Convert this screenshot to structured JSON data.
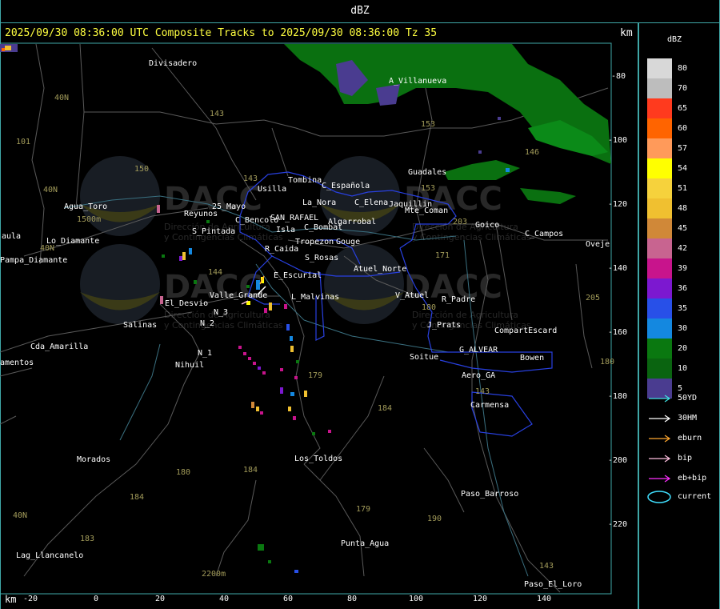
{
  "window": {
    "title": "dBZ"
  },
  "header": {
    "text": "2025/09/30 08:36:00 UTC Composite Tracks to 2025/09/30 08:36:00 Tz 35",
    "km_top": "km",
    "km_bottom": "km"
  },
  "axes": {
    "x_ticks": [
      "-20",
      "0",
      "20",
      "40",
      "60",
      "80",
      "100",
      "120",
      "140"
    ],
    "y_ticks": [
      "-80",
      "-100",
      "-120",
      "-140",
      "-160",
      "-180",
      "-200",
      "-220"
    ]
  },
  "legend": {
    "title": "dBZ",
    "levels": [
      {
        "label": "80",
        "color": "#d8d8d8"
      },
      {
        "label": "70",
        "color": "#bdbdbd"
      },
      {
        "label": "65",
        "color": "#ff3a1e"
      },
      {
        "label": "60",
        "color": "#ff6400"
      },
      {
        "label": "57",
        "color": "#ff9a5a"
      },
      {
        "label": "54",
        "color": "#ffff00"
      },
      {
        "label": "51",
        "color": "#f6d23c"
      },
      {
        "label": "48",
        "color": "#f0c030"
      },
      {
        "label": "45",
        "color": "#d08838"
      },
      {
        "label": "42",
        "color": "#c86490"
      },
      {
        "label": "39",
        "color": "#c8148c"
      },
      {
        "label": "36",
        "color": "#7c18d0"
      },
      {
        "label": "35",
        "color": "#2850e8"
      },
      {
        "label": "30",
        "color": "#1488e0"
      },
      {
        "label": "20",
        "color": "#0a7810"
      },
      {
        "label": "10",
        "color": "#0a6410"
      },
      {
        "label": "5",
        "color": "#4a3c90"
      }
    ],
    "tracks": [
      {
        "label": "50YD",
        "color": "#40e0e0"
      },
      {
        "label": "30HM",
        "color": "#ffffff"
      },
      {
        "label": "eburn",
        "color": "#ffa830"
      },
      {
        "label": "bip",
        "color": "#ffc0e0"
      },
      {
        "label": "eb+bip",
        "color": "#ff30ff"
      }
    ],
    "current": {
      "label": "current",
      "color": "#40e0ff"
    }
  },
  "places": [
    {
      "name": "Divisadero"
    },
    {
      "name": "A_Villanueva"
    },
    {
      "name": "Guadales"
    },
    {
      "name": "Tombina"
    },
    {
      "name": "Usilla"
    },
    {
      "name": "C_Española"
    },
    {
      "name": "Agua_Toro"
    },
    {
      "name": "Reyunos"
    },
    {
      "name": "25_Mayo"
    },
    {
      "name": "La_Nora"
    },
    {
      "name": "C_Elena"
    },
    {
      "name": "Jaquillin"
    },
    {
      "name": "Mte_Coman"
    },
    {
      "name": "Goico"
    },
    {
      "name": "C_Campos"
    },
    {
      "name": "Oveje"
    },
    {
      "name": "C_Bencolo"
    },
    {
      "name": "SAN_RAFAEL"
    },
    {
      "name": "Algarrobal"
    },
    {
      "name": "C_Bombal"
    },
    {
      "name": "aula"
    },
    {
      "name": "S_Pintada"
    },
    {
      "name": "Lo_Diamante"
    },
    {
      "name": "Isla"
    },
    {
      "name": "Tropezon"
    },
    {
      "name": "Gouge"
    },
    {
      "name": "Pampa_Diamante"
    },
    {
      "name": "R_Caida"
    },
    {
      "name": "S_Rosas"
    },
    {
      "name": "Atuel_Norte"
    },
    {
      "name": "E_Escurial"
    },
    {
      "name": "Valle_Grande"
    },
    {
      "name": "L_Malvinas"
    },
    {
      "name": "V_Atuel"
    },
    {
      "name": "R_Padre"
    },
    {
      "name": "El_Desvio"
    },
    {
      "name": "Salinas"
    },
    {
      "name": "N_2"
    },
    {
      "name": "J_Prats"
    },
    {
      "name": "CompartEscard"
    },
    {
      "name": "N_3"
    },
    {
      "name": "Cda_Amarilla"
    },
    {
      "name": "G_ALVEAR"
    },
    {
      "name": "N_1"
    },
    {
      "name": "Soitue"
    },
    {
      "name": "Bowen"
    },
    {
      "name": "amentos"
    },
    {
      "name": "Nihuil"
    },
    {
      "name": "Aero_GA"
    },
    {
      "name": "Carmensa"
    },
    {
      "name": "Morados"
    },
    {
      "name": "Los_Toldos"
    },
    {
      "name": "Paso_Barroso"
    },
    {
      "name": "Punta_Agua"
    },
    {
      "name": "Lag_Llancanelo"
    },
    {
      "name": "Paso_El_Loro"
    }
  ],
  "road_numbers": [
    "40N",
    "101",
    "143",
    "150",
    "40N",
    "153",
    "146",
    "143",
    "153",
    "203",
    "40N",
    "171",
    "144",
    "180",
    "205",
    "184",
    "179",
    "180",
    "184",
    "179",
    "190",
    "184",
    "143",
    "183",
    "143",
    "40N",
    "180"
  ],
  "elevation_labels": [
    "1500m",
    "2200m"
  ],
  "watermark": {
    "logo": "DACC",
    "line1": "Dirección de Agricultura",
    "line2": "y Contingencias Climáticas"
  }
}
